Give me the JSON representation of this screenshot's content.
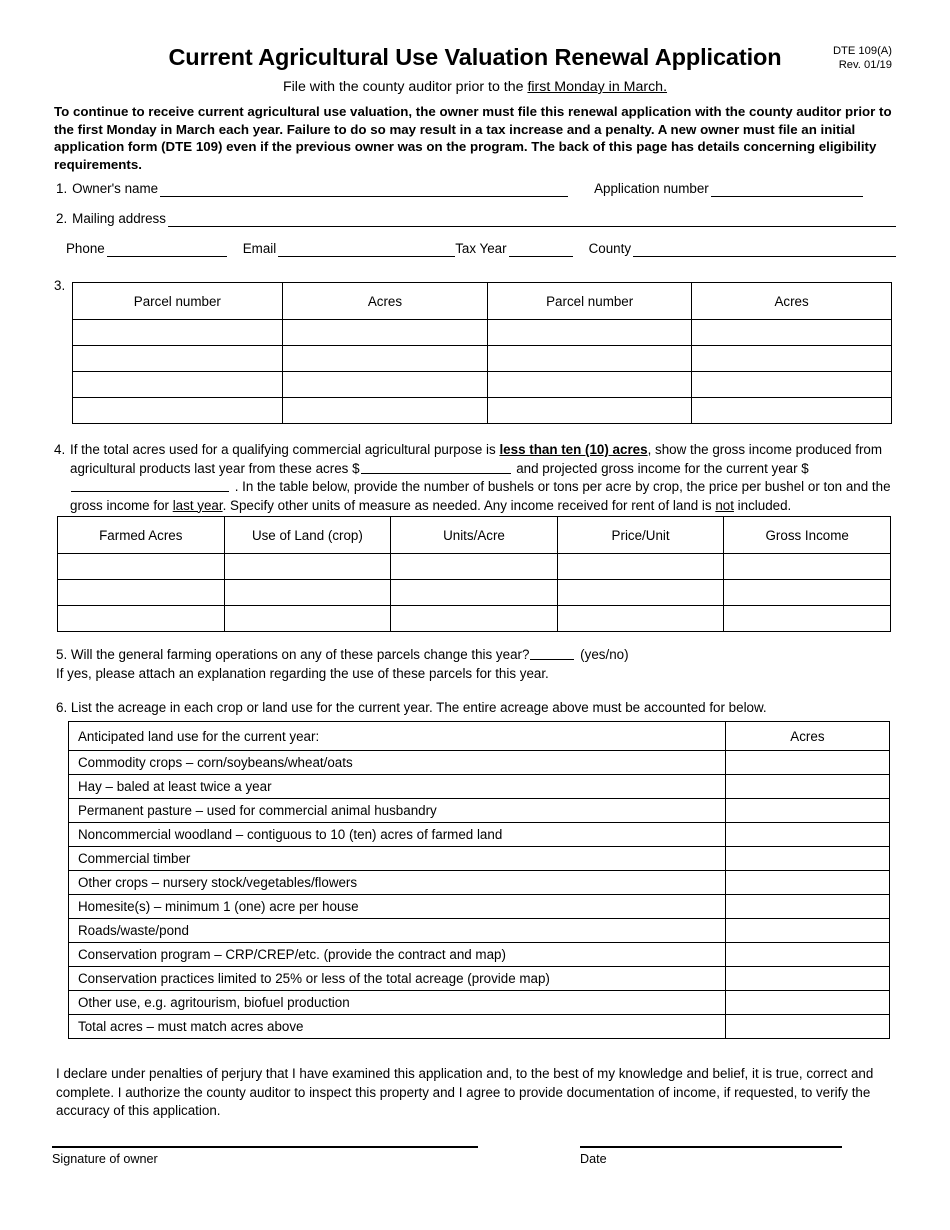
{
  "header": {
    "title": "Current Agricultural Use Valuation Renewal Application",
    "subtitle_prefix": "File with the county auditor prior to the ",
    "subtitle_underlined": "first Monday in March.",
    "form_number": "DTE 109(A)",
    "revision": "Rev. 01/19"
  },
  "intro": {
    "text": "To continue to receive current agricultural use valuation, the owner must file this renewal application with the county auditor prior to the first Monday in March each year. Failure to do so may result in a tax increase and a penalty. A new owner must file an initial application form (DTE 109) even if the previous owner was on the program. The back of this page has details concerning eligibility requirements."
  },
  "fields": {
    "item1_number": "1.",
    "owner_name_label": "Owner's name",
    "owner_name_value": "",
    "application_number_label": "Application number",
    "application_number_value": "",
    "item2_number": "2.",
    "mailing_address_label": "Mailing address",
    "mailing_address_value": "",
    "phone_label": "Phone",
    "phone_value": "",
    "email_label": "Email",
    "email_value": "",
    "tax_year_label": "Tax Year",
    "tax_year_value": "",
    "county_label": "County",
    "county_value": ""
  },
  "parcel_section": {
    "item_number": "3.",
    "columns": [
      "Parcel number",
      "Acres",
      "Parcel number",
      "Acres"
    ],
    "rows": [
      [
        "",
        "",
        "",
        ""
      ],
      [
        "",
        "",
        "",
        ""
      ],
      [
        "",
        "",
        "",
        ""
      ],
      [
        "",
        "",
        "",
        ""
      ]
    ]
  },
  "item4": {
    "number": "4.",
    "seg1": "If the total acres used for a qualifying commercial agricultural purpose is ",
    "bold1": "less than ten (10) acres",
    "seg2": ", show the gross income produced from agricultural products last year from these acres $",
    "blank1_value": "",
    "seg3": " and projected gross income for the current year $",
    "blank2_value": "",
    "seg4": " . In the table below, provide the number of bushels or tons per acre by crop, the price per bushel or ton and the gross income for ",
    "underline1": "last year",
    "seg5": ". Specify other units of measure as needed. Any income received for rent of land is ",
    "underline2": "not",
    "seg6": " included."
  },
  "crop_section": {
    "columns": [
      "Farmed Acres",
      "Use of Land (crop)",
      "Units/Acre",
      "Price/Unit",
      "Gross Income"
    ],
    "rows": [
      [
        "",
        "",
        "",
        "",
        ""
      ],
      [
        "",
        "",
        "",
        "",
        ""
      ],
      [
        "",
        "",
        "",
        "",
        ""
      ]
    ]
  },
  "item5": {
    "number": "5.",
    "question": "Will the general farming operations on any of these parcels change this year?",
    "answer_value": "",
    "yesno_hint": "(yes/no)",
    "note": "If yes, please attach an explanation regarding the use of these parcels for this year."
  },
  "item6": {
    "number": "6.",
    "text": "List the acreage in each crop or land use for the current year. The entire acreage above must be accounted for below."
  },
  "landuse_section": {
    "header_label": "Anticipated land use for the current year:",
    "header_acres": "Acres",
    "rows": [
      {
        "label": "Commodity crops – corn/soybeans/wheat/oats",
        "acres": ""
      },
      {
        "label": "Hay – baled at least twice a year",
        "acres": ""
      },
      {
        "label": "Permanent pasture – used for commercial animal husbandry",
        "acres": ""
      },
      {
        "label": "Noncommercial woodland – contiguous to 10 (ten) acres of farmed land",
        "acres": ""
      },
      {
        "label": "Commercial timber",
        "acres": ""
      },
      {
        "label": "Other crops – nursery stock/vegetables/flowers",
        "acres": ""
      },
      {
        "label": "Homesite(s) – minimum 1 (one) acre per house",
        "acres": ""
      },
      {
        "label": "Roads/waste/pond",
        "acres": ""
      },
      {
        "label": "Conservation program – CRP/CREP/etc. (provide the contract and map)",
        "acres": ""
      },
      {
        "label": "Conservation practices limited to 25% or less of the total acreage (provide map)",
        "acres": ""
      },
      {
        "label": "Other use, e.g. agritourism, biofuel production",
        "acres": ""
      },
      {
        "label": "Total acres – must match acres above",
        "acres": ""
      }
    ]
  },
  "declaration": {
    "text": "I declare under penalties of perjury that I have examined this application and, to the best of my knowledge and belief, it is true, correct and complete. I authorize the county auditor to inspect this property and I agree to provide documentation of income, if requested, to verify the accuracy of this application."
  },
  "signature": {
    "owner_label": "Signature of owner",
    "owner_value": "",
    "date_label": "Date",
    "date_value": ""
  }
}
